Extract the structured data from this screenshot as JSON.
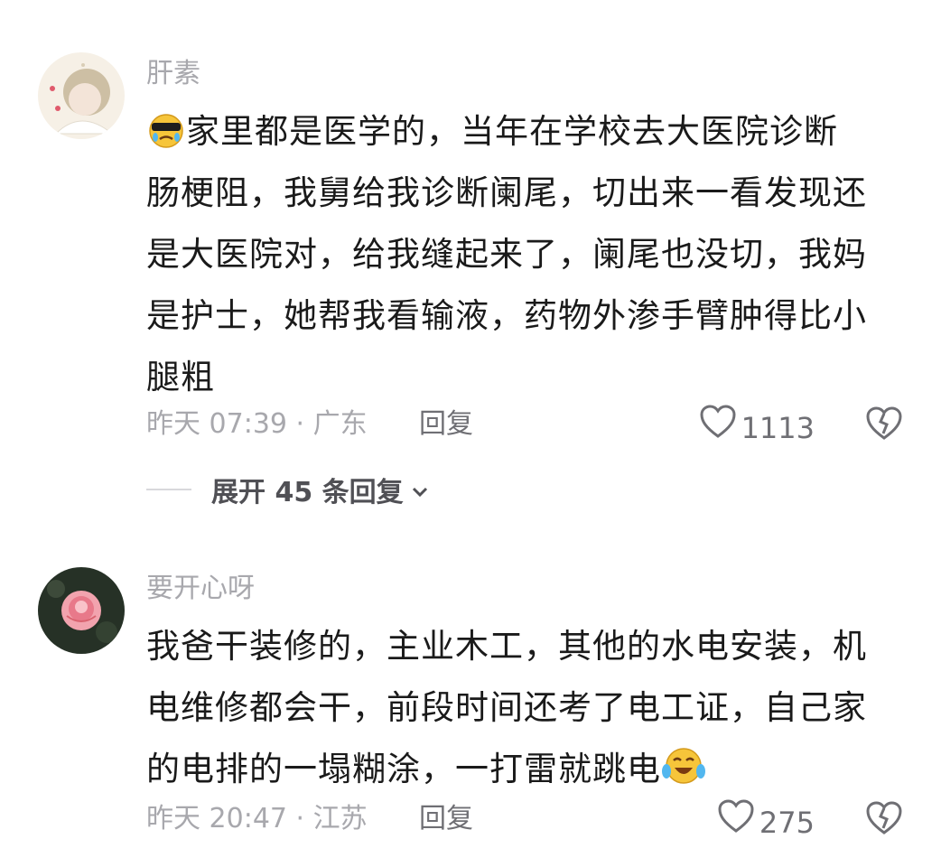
{
  "comments": [
    {
      "username": "肝素",
      "lines": [
        "家里都是医学的，当年在学校去大医院诊断",
        "肠梗阻，我舅给我诊断阑尾，切出来一看发现还",
        "是大医院对，给我缝起来了，阑尾也没切，我妈",
        "是护士，她帮我看输液，药物外渗手臂肿得比小",
        "腿粗"
      ],
      "leading_emoji": "cool-crying-emoji",
      "time_location": "昨天 07:39 · 广东",
      "reply_label": "回复",
      "likes": "1113",
      "expand_label": "展开 45 条回复"
    },
    {
      "username": "要开心呀",
      "lines": [
        "我爸干装修的，主业木工，其他的水电安装，机",
        "电维修都会干，前段时间还考了电工证，自己家",
        "的电排的一塌糊涂，一打雷就跳电"
      ],
      "trailing_emoji": "crying-laughing-emoji",
      "time_location": "昨天 20:47 · 江苏",
      "reply_label": "回复",
      "likes": "275"
    }
  ]
}
